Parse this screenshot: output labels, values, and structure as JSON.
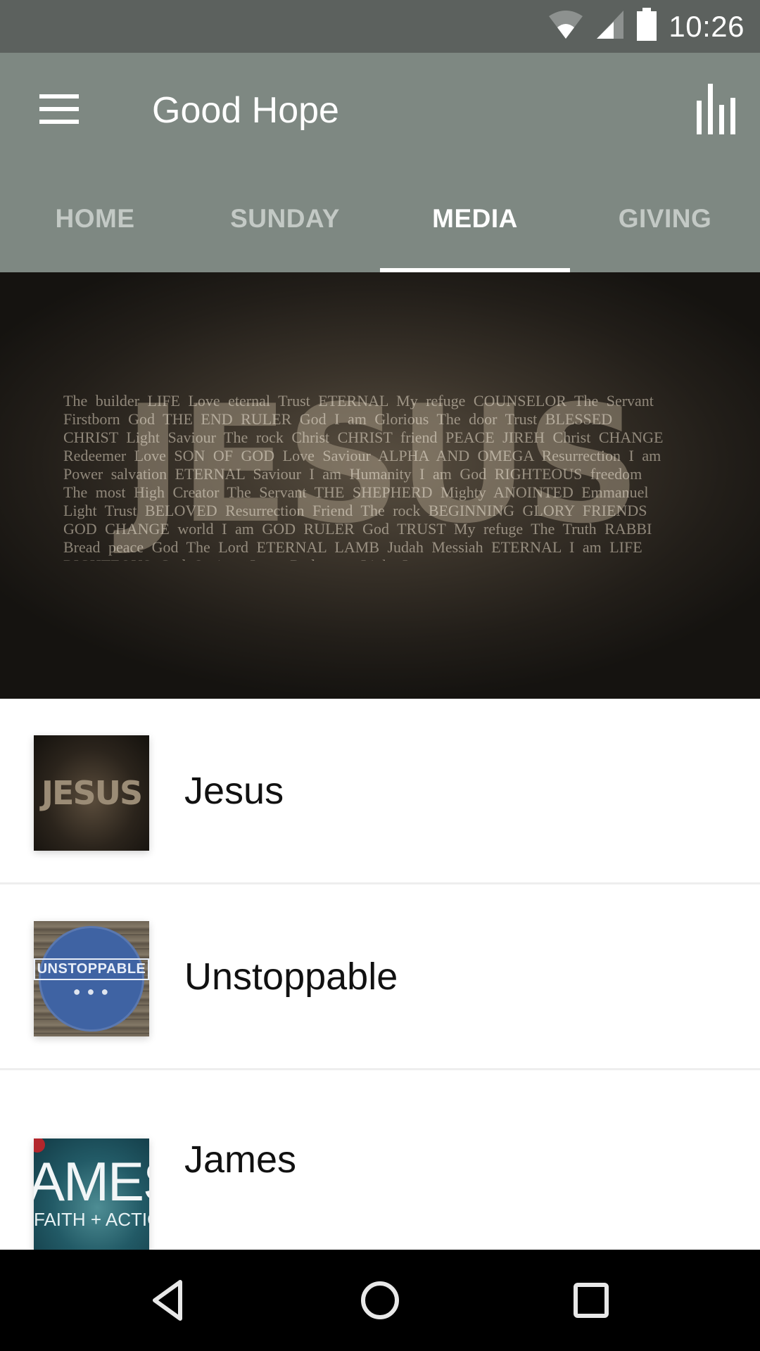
{
  "status_bar": {
    "time": "10:26",
    "icons": [
      "wifi-icon",
      "cell-signal-icon",
      "battery-icon"
    ]
  },
  "app_bar": {
    "title": "Good Hope",
    "left_icon": "menu-icon",
    "right_icon": "bar-chart-icon"
  },
  "tabs": [
    {
      "label": "HOME",
      "active": false
    },
    {
      "label": "SUNDAY",
      "active": false
    },
    {
      "label": "MEDIA",
      "active": true
    },
    {
      "label": "GIVING",
      "active": false
    }
  ],
  "banner": {
    "title": "JESUS",
    "word_cloud": "The builder LIFE Love eternal Trust ETERNAL My refuge COUNSELOR The Servant Firstborn God THE END RULER God I am Glorious The door Trust BLESSED CHRIST Light Saviour The rock Christ CHRIST friend PEACE JIREH Christ CHANGE Redeemer Love SON OF GOD Love Saviour ALPHA AND OMEGA Resurrection I am Power salvation ETERNAL Saviour I am Humanity I am God RIGHTEOUS freedom The most High Creator The Servant THE SHEPHERD Mighty ANOINTED Emmanuel Light Trust BELOVED Resurrection Friend The rock BEGINNING GLORY FRIENDS GOD CHANGE world I am GOD RULER God TRUST My refuge The Truth RABBI Bread peace God The Lord ETERNAL LAMB Judah Messiah ETERNAL I am LIFE RIGHTEOUS God Saviour Love Redeemer Light Love",
    "page_count": 2,
    "current_page": 1
  },
  "media_list": [
    {
      "title": "Jesus",
      "thumb_text": "JESUS"
    },
    {
      "title": "Unstoppable",
      "thumb_text": "UNSTOPPABLE"
    },
    {
      "title": "James",
      "thumb_text": "AMES",
      "thumb_subtext": "FAITH + ACTIO"
    }
  ],
  "nav_bar": {
    "buttons": [
      "back-icon",
      "home-icon",
      "recents-icon"
    ]
  },
  "colors": {
    "status_bar": "#5c615e",
    "app_bar": "#7e8882",
    "tab_inactive": "#c3c9c5",
    "tab_active": "#ffffff"
  }
}
